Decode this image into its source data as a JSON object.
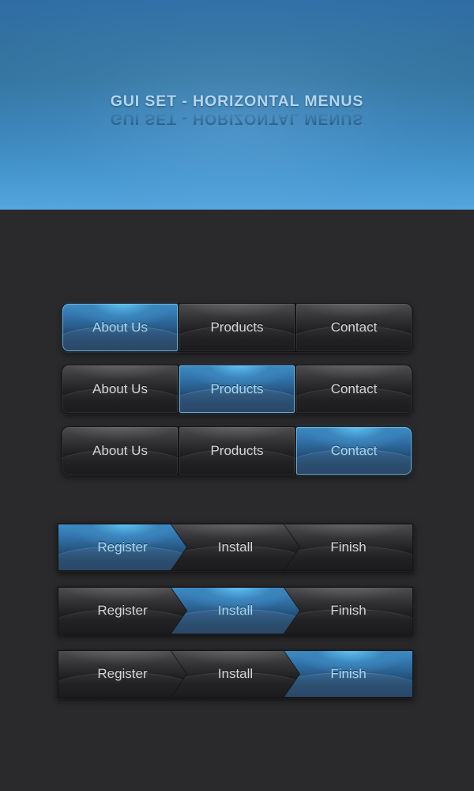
{
  "header": {
    "title": "GUI SET - HORIZONTAL MENUS",
    "accent_blue": "#4596cf",
    "title_color": "#b3d6ef"
  },
  "theme": {
    "background": "#2a2a2c",
    "active_text": "#a5d8f2",
    "inactive_text": "#d6d6d6",
    "active_blue_top": "#6fc9ef",
    "active_blue_bottom": "#1a3a5c",
    "dark_top": "#4c4c4e",
    "dark_bottom": "#0e0e10"
  },
  "tab_menus": [
    {
      "name": "tab-menu-about-active",
      "items": [
        {
          "label": "About Us",
          "active": true
        },
        {
          "label": "Products",
          "active": false
        },
        {
          "label": "Contact",
          "active": false
        }
      ]
    },
    {
      "name": "tab-menu-products-active",
      "items": [
        {
          "label": "About Us",
          "active": false
        },
        {
          "label": "Products",
          "active": true
        },
        {
          "label": "Contact",
          "active": false
        }
      ]
    },
    {
      "name": "tab-menu-contact-active",
      "items": [
        {
          "label": "About Us",
          "active": false
        },
        {
          "label": "Products",
          "active": false
        },
        {
          "label": "Contact",
          "active": true
        }
      ]
    }
  ],
  "breadcrumb_menus": [
    {
      "name": "wizard-register-active",
      "items": [
        {
          "label": "Register",
          "active": true
        },
        {
          "label": "Install",
          "active": false
        },
        {
          "label": "Finish",
          "active": false
        }
      ]
    },
    {
      "name": "wizard-install-active",
      "items": [
        {
          "label": "Register",
          "active": false
        },
        {
          "label": "Install",
          "active": true
        },
        {
          "label": "Finish",
          "active": false
        }
      ]
    },
    {
      "name": "wizard-finish-active",
      "items": [
        {
          "label": "Register",
          "active": false
        },
        {
          "label": "Install",
          "active": false
        },
        {
          "label": "Finish",
          "active": true
        }
      ]
    }
  ]
}
